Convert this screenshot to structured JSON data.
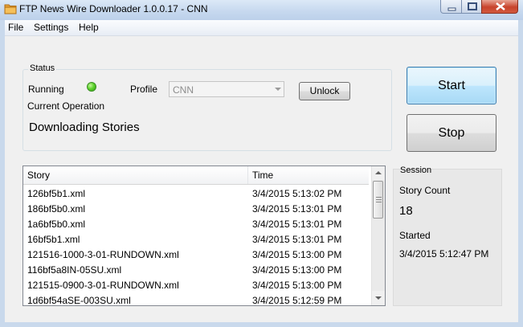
{
  "window": {
    "title": "FTP News Wire Downloader 1.0.0.17 - CNN"
  },
  "menu": {
    "items": [
      "File",
      "Settings",
      "Help"
    ]
  },
  "status": {
    "group_title": "Status",
    "running_label": "Running",
    "running_indicator_color": "#4fc42a",
    "profile_label": "Profile",
    "profile_value": "CNN",
    "unlock_label": "Unlock",
    "current_operation_label": "Current Operation",
    "current_operation_value": "Downloading Stories"
  },
  "controls": {
    "start_label": "Start",
    "stop_label": "Stop"
  },
  "stories": {
    "columns": [
      "Story",
      "Time"
    ],
    "rows": [
      {
        "story": "126bf5b1.xml",
        "time": "3/4/2015 5:13:02 PM"
      },
      {
        "story": "186bf5b0.xml",
        "time": "3/4/2015 5:13:01 PM"
      },
      {
        "story": "1a6bf5b0.xml",
        "time": "3/4/2015 5:13:01 PM"
      },
      {
        "story": "16bf5b1.xml",
        "time": "3/4/2015 5:13:01 PM"
      },
      {
        "story": "121516-1000-3-01-RUNDOWN.xml",
        "time": "3/4/2015 5:13:00 PM"
      },
      {
        "story": "116bf5a8IN-05SU.xml",
        "time": "3/4/2015 5:13:00 PM"
      },
      {
        "story": "121515-0900-3-01-RUNDOWN.xml",
        "time": "3/4/2015 5:13:00 PM"
      },
      {
        "story": "1d6bf54aSE-003SU.xml",
        "time": "3/4/2015 5:12:59 PM"
      }
    ]
  },
  "session": {
    "title": "Session",
    "story_count_label": "Story Count",
    "story_count_value": "18",
    "started_label": "Started",
    "started_value": "3/4/2015 5:12:47 PM"
  }
}
